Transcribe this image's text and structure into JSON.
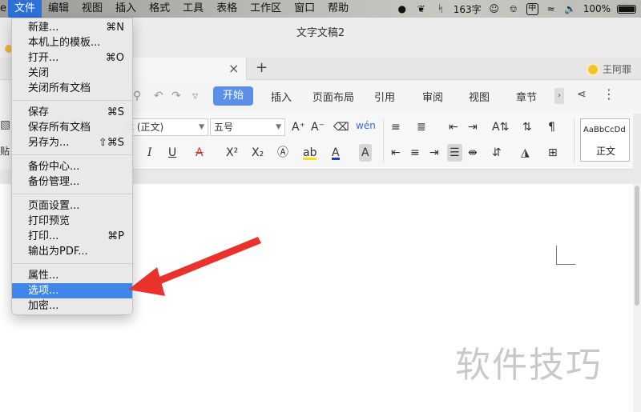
{
  "menubar": {
    "edge_label": "e",
    "items": [
      "文件",
      "编辑",
      "视图",
      "插入",
      "格式",
      "工具",
      "表格",
      "工作区",
      "窗口",
      "帮助"
    ],
    "status_chars": "163字",
    "battery": "100%"
  },
  "window": {
    "doc_title": "文字文稿2",
    "user_name": "王阿罪"
  },
  "ribbon": {
    "tabs": [
      "开始",
      "插入",
      "页面布局",
      "引用",
      "审阅",
      "视图",
      "章节"
    ],
    "font_name": "体 (正文)",
    "font_size": "五号",
    "pinyin": "wén",
    "style_sample": "AaBbCcDd",
    "style_name": "正文",
    "left_paste": "贴"
  },
  "file_menu": {
    "items": [
      {
        "label": "新建...",
        "shortcut": "⌘N"
      },
      {
        "label": "本机上的模板...",
        "shortcut": ""
      },
      {
        "label": "打开...",
        "shortcut": "⌘O"
      },
      {
        "label": "关闭",
        "shortcut": ""
      },
      {
        "label": "关闭所有文档",
        "shortcut": ""
      },
      {
        "label": "保存",
        "shortcut": "⌘S"
      },
      {
        "label": "保存所有文档",
        "shortcut": ""
      },
      {
        "label": "另存为...",
        "shortcut": "⇧⌘S"
      },
      {
        "label": "备份中心...",
        "shortcut": ""
      },
      {
        "label": "备份管理...",
        "shortcut": ""
      },
      {
        "label": "页面设置...",
        "shortcut": ""
      },
      {
        "label": "打印预览",
        "shortcut": ""
      },
      {
        "label": "打印...",
        "shortcut": "⌘P"
      },
      {
        "label": "输出为PDF...",
        "shortcut": ""
      },
      {
        "label": "属性...",
        "shortcut": ""
      },
      {
        "label": "选项...",
        "shortcut": ""
      },
      {
        "label": "加密...",
        "shortcut": ""
      }
    ],
    "highlighted": "选项..."
  },
  "watermark": "软件技巧",
  "colors": {
    "accent": "#3f86e8",
    "ribbon_active": "#5b8fe8",
    "annotation_arrow": "#e8322b"
  }
}
